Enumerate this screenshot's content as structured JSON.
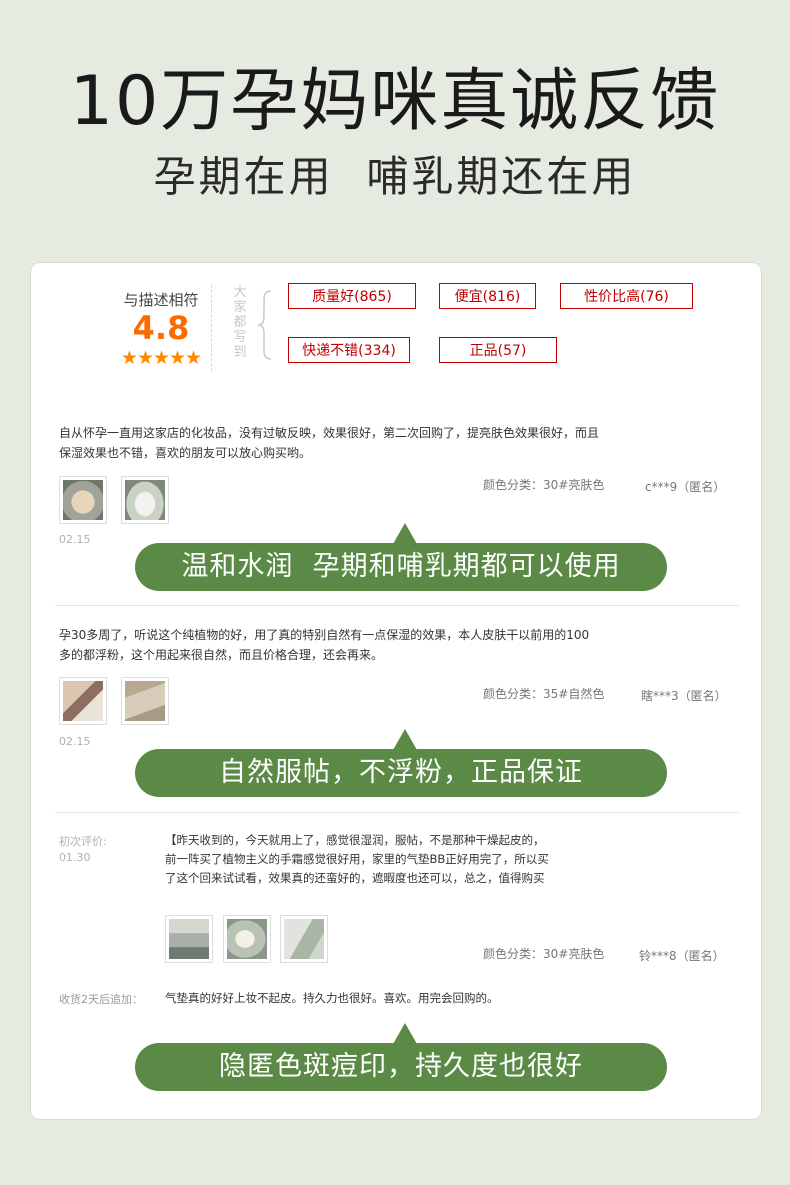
{
  "header": {
    "title": "10万孕妈咪真诚反馈",
    "subtitle": "孕期在用  哺乳期还在用"
  },
  "rating": {
    "label": "与描述相符",
    "score": "4.8",
    "stars": "★★★★★",
    "everyone_wrote": "大家都写到"
  },
  "tags": [
    {
      "label": "质量好(865)"
    },
    {
      "label": "便宜(816)"
    },
    {
      "label": "性价比高(76)"
    },
    {
      "label": "快递不错(334)"
    },
    {
      "label": "正品(57)"
    }
  ],
  "reviews": [
    {
      "text": "自从怀孕一直用这家店的化妆品，没有过敏反映，效果很好，第二次回购了，提亮肤色效果很好，而且保湿效果也不错，喜欢的朋友可以放心购买哟。",
      "variant": "颜色分类：30#亮肤色",
      "user": "c***9（匿名）",
      "date": "02.15",
      "banner": "温和水润  孕期和哺乳期都可以使用"
    },
    {
      "text": "孕30多周了，听说这个纯植物的好，用了真的特别自然有一点保湿的效果，本人皮肤干以前用的100多的都浮粉，这个用起来很自然，而且价格合理，还会再来。",
      "variant": "颜色分类：35#自然色",
      "user": "瞎***3（匿名）",
      "date": "02.15",
      "banner": "自然服帖，不浮粉，正品保证"
    },
    {
      "initial_label": "初次评价:",
      "date": "01.30",
      "text": "【昨天收到的，今天就用上了，感觉很湿润，服帖，不是那种干燥起皮的，前一阵买了植物主义的手霜感觉很好用，家里的气垫BB正好用完了，所以买了这个回来试试看，效果真的还蛮好的，遮暇度也还可以，总之，值得购买",
      "variant": "颜色分类：30#亮肤色",
      "user": "铃***8（匿名）",
      "followup_label": "收货2天后追加：",
      "followup_text": "气垫真的好好上妆不起皮。持久力也很好。喜欢。用完会回购的。",
      "banner": "隐匿色斑痘印，持久度也很好"
    }
  ],
  "colors": {
    "background": "#e6ebe2",
    "banner_green": "#5a8a46",
    "tag_red": "#c00000",
    "score_orange": "#ff6a00"
  }
}
